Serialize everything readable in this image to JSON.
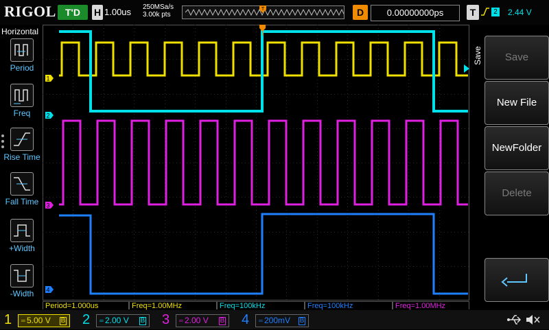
{
  "header": {
    "logo": "RIGOL",
    "trigger_status": "T'D",
    "horizontal_key": "H",
    "timebase": "1.00us",
    "sample_rate": "250MSa/s",
    "memory_depth": "3.00k pts",
    "delay_key": "D",
    "delay_value": "0.00000000ps",
    "trigger_key": "T",
    "trigger_slope_icon": "rising-edge-icon",
    "trigger_channel": "2",
    "trigger_level": "2.44 V"
  },
  "left_menu": {
    "title": "Horizontal",
    "items": [
      {
        "label": "Period",
        "icon": "period-icon"
      },
      {
        "label": "Freq",
        "icon": "frequency-icon"
      },
      {
        "label": "Rise Time",
        "icon": "rise-time-icon"
      },
      {
        "label": "Fall Time",
        "icon": "fall-time-icon"
      },
      {
        "label": "+Width",
        "icon": "positive-width-icon"
      },
      {
        "label": "-Width",
        "icon": "negative-width-icon"
      }
    ]
  },
  "right_menu": {
    "title": "Save",
    "buttons": [
      {
        "label": "Save",
        "enabled": false
      },
      {
        "label": "New File",
        "enabled": true
      },
      {
        "label": "NewFolder",
        "enabled": true
      },
      {
        "label": "Delete",
        "enabled": false
      },
      {
        "label": "",
        "icon": "return-arrow-icon",
        "enabled": true
      }
    ]
  },
  "measurements": [
    {
      "text": "Period=1.000us",
      "color": "#f0e000"
    },
    {
      "text": "Freq=1.00MHz",
      "color": "#f0e000"
    },
    {
      "text": "Freq=100kHz",
      "color": "#00e0e8"
    },
    {
      "text": "Freq=100kHz",
      "color": "#1e7fff"
    },
    {
      "text": "Freq=1.00MHz",
      "color": "#e020e0"
    }
  ],
  "channels": [
    {
      "num": "1",
      "scale": "5.00 V",
      "color": "#f0e000"
    },
    {
      "num": "2",
      "scale": "2.00 V",
      "color": "#00e0e8"
    },
    {
      "num": "3",
      "scale": "2.00 V",
      "color": "#e020e0"
    },
    {
      "num": "4",
      "scale": "200mV",
      "color": "#1e7fff"
    }
  ],
  "status_icons": [
    "usb-icon",
    "speaker-muted-icon"
  ],
  "colors": {
    "ch1": "#f0e000",
    "ch2": "#00e0e8",
    "ch3": "#e020e0",
    "ch4": "#1e7fff",
    "trigger": "#f08a00",
    "accent_green": "#1a8a2a"
  }
}
